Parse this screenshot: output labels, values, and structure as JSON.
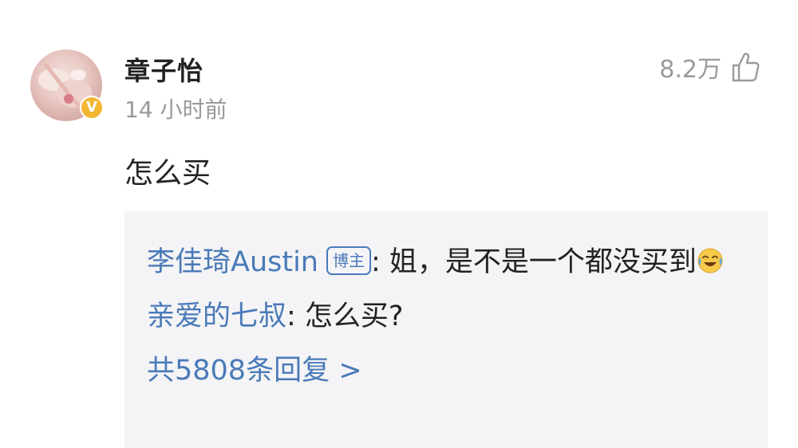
{
  "comment": {
    "username": "章子怡",
    "timestamp": "14 小时前",
    "likes": "8.2万",
    "text": "怎么买",
    "verified_badge": "V"
  },
  "replies": {
    "items": [
      {
        "name": "李佳琦Austin",
        "badge": "博主",
        "text": ": 姐，是不是一个都没买到",
        "emoji": "tears-of-joy-emoji"
      },
      {
        "name": "亲爱的七叔",
        "text": ": 怎么买?"
      }
    ],
    "more_label": "共5808条回复 >"
  },
  "icons": {
    "like": "thumbs-up-icon",
    "verified": "verified-badge-icon"
  },
  "colors": {
    "link": "#4a7ab8",
    "muted": "#9a9a9a",
    "reply_bg": "#f4f4f6",
    "badge": "#f2b632"
  }
}
